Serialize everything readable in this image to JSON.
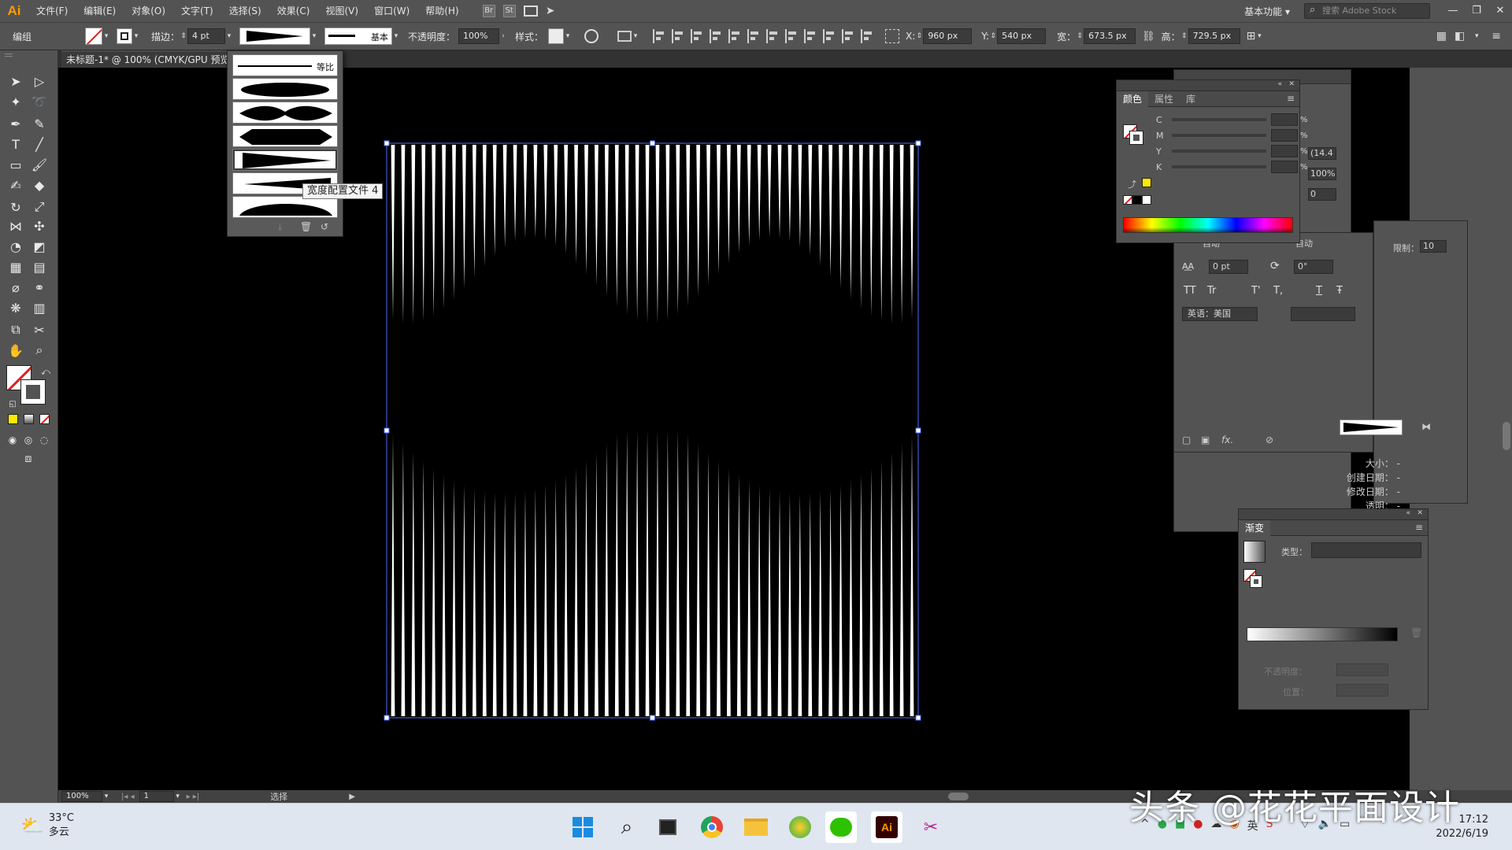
{
  "app": {
    "logo": "Ai"
  },
  "menu": [
    "文件(F)",
    "编辑(E)",
    "对象(O)",
    "文字(T)",
    "选择(S)",
    "效果(C)",
    "视图(V)",
    "窗口(W)",
    "帮助(H)"
  ],
  "menu_icons": {
    "br": "Br",
    "st": "St"
  },
  "top_right": {
    "workspace": "基本功能",
    "stock_placeholder": "搜索 Adobe Stock"
  },
  "control": {
    "mode": "编组",
    "stroke_label": "描边：",
    "stroke_value": "4 pt",
    "brush_name": "基本",
    "opacity_label": "不透明度：",
    "opacity_value": "100%",
    "style_label": "样式：",
    "x_label": "X:",
    "x_value": "960 px",
    "y_label": "Y:",
    "y_value": "540 px",
    "w_label": "宽：",
    "w_value": "673.5 px",
    "h_label": "高：",
    "h_value": "729.5 px"
  },
  "document": {
    "tab_title": "未标题-1* @ 100% (CMYK/GPU 预览)"
  },
  "profiles": {
    "first_label": "等比",
    "tooltip": "宽度配置文件 4"
  },
  "color_panel": {
    "tabs": [
      "颜色",
      "属性",
      "库"
    ],
    "channels": [
      "C",
      "M",
      "Y",
      "K"
    ],
    "percent": "%"
  },
  "char_panel": {
    "tracking": "0 pt",
    "rotation": "0°",
    "language": "英语：美国",
    "auto1": "自动",
    "auto2": "自动",
    "size": "(14.4",
    "scale": "100%",
    "baseline": "0",
    "tt1": "TT",
    "tt2": "Tr",
    "tt3": "T'",
    "tt4": "T,",
    "tt5": "T",
    "tt6": "Ŧ",
    "limit_label": "限制：",
    "limit_value": "10"
  },
  "info_panel": {
    "size": "大小：",
    "created": "创建日期：",
    "modified": "修改日期：",
    "transparent": "透明：",
    "dash": "-"
  },
  "gradient_panel": {
    "title": "渐变",
    "type_label": "类型：",
    "opacity_label": "不透明度：",
    "position_label": "位置："
  },
  "status": {
    "zoom": "100%",
    "page": "1",
    "mode": "选择"
  },
  "taskbar": {
    "temperature": "33°C",
    "weather": "多云",
    "ime": "英",
    "time": "17:12",
    "date": "2022/6/19"
  },
  "watermark": "头条 @花花平面设计",
  "colors": {
    "selection": "#4a6cff",
    "accent": "#ff9a00",
    "line": "#ffffff"
  }
}
